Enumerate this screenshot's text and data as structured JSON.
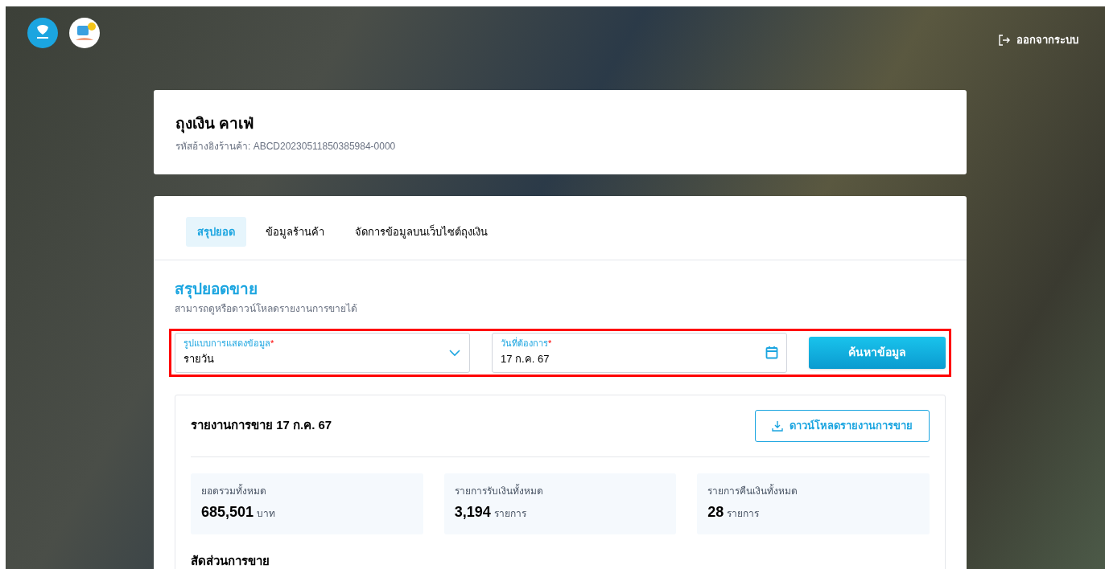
{
  "top_bar": {
    "logout": "ออกจากระบบ"
  },
  "store": {
    "name": "ถุงเงิน คาเฟ่",
    "reference": "รหัสอ้างอิงร้านค้า: ABCD20230511850385984-0000"
  },
  "tabs": [
    {
      "label": "สรุปยอด",
      "selected": true
    },
    {
      "label": "ข้อมูลร้านค้า",
      "selected": false
    },
    {
      "label": "จัดการข้อมูลบนเว็บไซต์ถุงเงิน",
      "selected": false
    }
  ],
  "section": {
    "title": "สรุปยอดขาย",
    "subtitle": "สามารถดูหรือดาวน์โหลดรายงานการขายได้"
  },
  "filters": [
    {
      "kind": "select",
      "label": "รูปแบบการแสดงข้อมูล",
      "required_mark": "*",
      "value": "รายวัน"
    },
    {
      "kind": "date",
      "label": "วันที่ต้องการ",
      "required_mark": "*",
      "value": "17 ก.ค. 67"
    }
  ],
  "search_button": "ค้นหาข้อมูล",
  "report": {
    "title": "รายงานการขาย 17 ก.ค. 67",
    "download_button": "ดาวน์โหลดรายงานการขาย",
    "stats": [
      {
        "label": "ยอดรวมทั้งหมด",
        "value": "685,501",
        "unit": "บาท"
      },
      {
        "label": "รายการรับเงินทั้งหมด",
        "value": "3,194",
        "unit": "รายการ"
      },
      {
        "label": "รายการคืนเงินทั้งหมด",
        "value": "28",
        "unit": "รายการ"
      }
    ],
    "breakdown_title": "สัดส่วนการขาย"
  }
}
